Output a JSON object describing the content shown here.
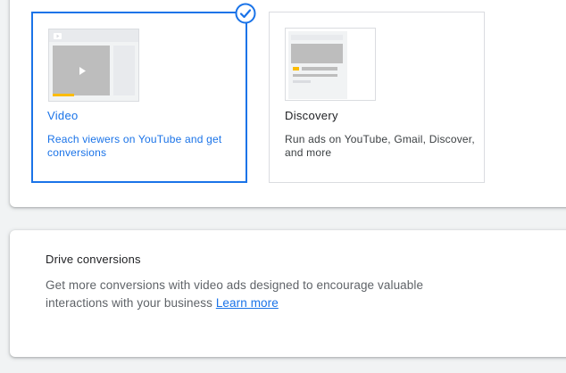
{
  "campaign_types": [
    {
      "title": "Video",
      "description": "Reach viewers on YouTube and get conversions",
      "selected": true,
      "icon": "video-thumbnail-icon"
    },
    {
      "title": "Discovery",
      "description": "Run ads on YouTube, Gmail, Discover, and more",
      "selected": false,
      "icon": "discovery-thumbnail-icon"
    }
  ],
  "subtype": {
    "title": "Drive conversions",
    "description": "Get more conversions with video ads designed to encourage valuable interactions with your business",
    "learn_more": "Learn more"
  },
  "colors": {
    "accent": "#1a73e8",
    "highlight": "#fbbc04",
    "placeholder": "#bdbdbd"
  }
}
